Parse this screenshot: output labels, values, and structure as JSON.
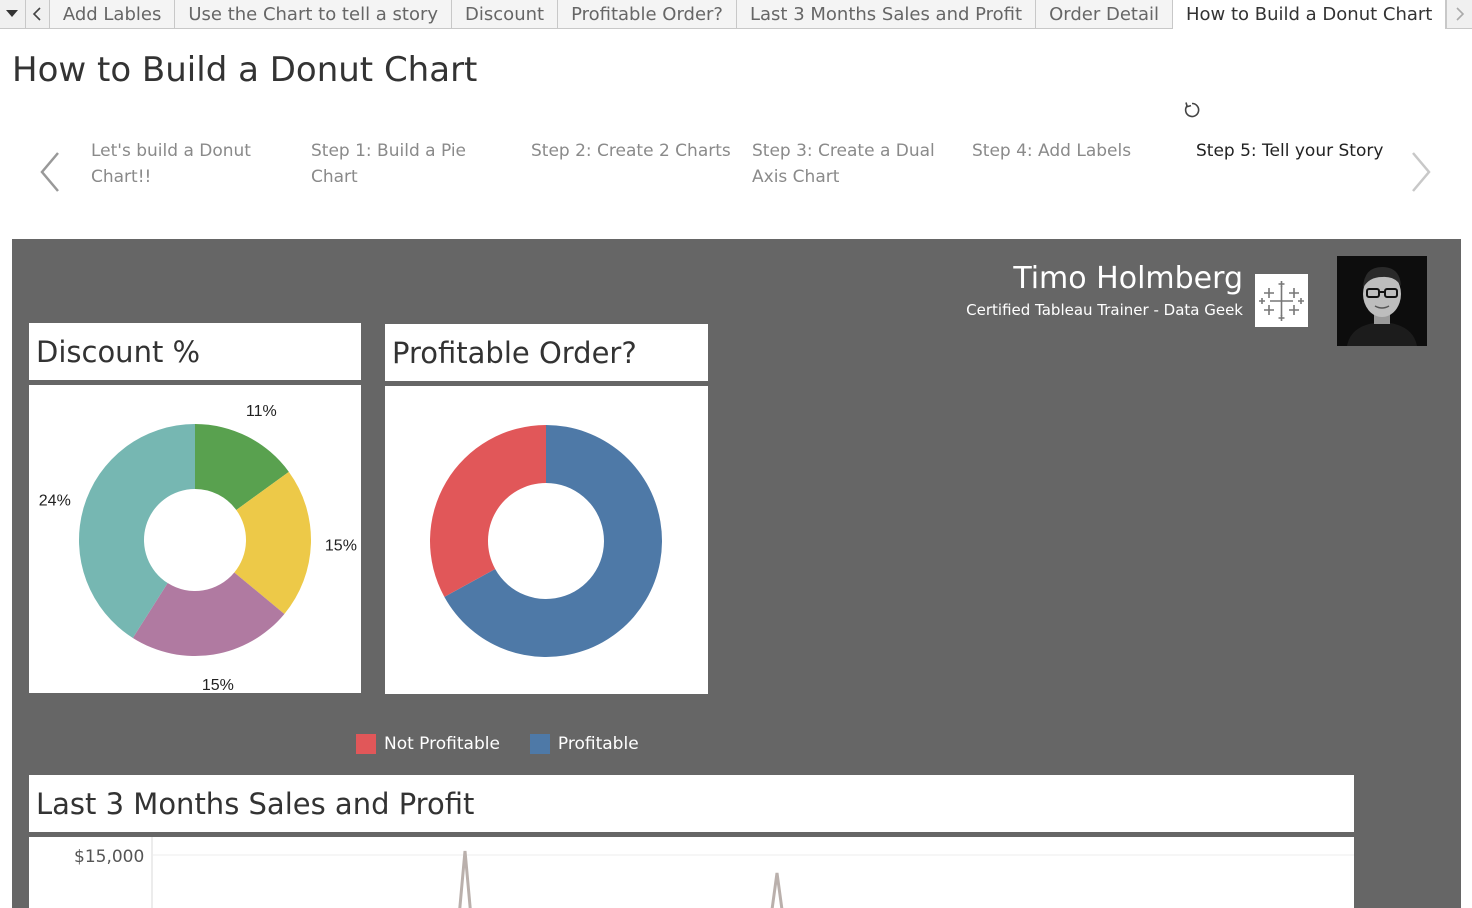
{
  "tabs": {
    "items": [
      "Add Lables",
      "Use the Chart to tell a story",
      "Discount",
      "Profitable Order?",
      "Last 3 Months Sales and Profit",
      "Order Detail",
      "How to Build a Donut Chart"
    ],
    "active": "How to Build a Donut Chart"
  },
  "page": {
    "title": "How to Build a Donut Chart"
  },
  "story": {
    "steps": [
      {
        "label": "Let's build a Donut Chart!!"
      },
      {
        "label": "Step 1: Build a Pie Chart"
      },
      {
        "label": "Step 2: Create 2 Charts"
      },
      {
        "label": "Step 3: Create a Dual Axis Chart"
      },
      {
        "label": "Step 4: Add Labels"
      },
      {
        "label": "Step 5: Tell your Story"
      }
    ],
    "active_index": 5
  },
  "author": {
    "name": "Timo Holmberg",
    "subtitle": "Certified Tableau Trainer - Data Geek"
  },
  "colors": {
    "dashboard_bg": "#666666",
    "green": "#59a14f",
    "yellow": "#edc948",
    "purple": "#b07aa1",
    "teal": "#76b7b2",
    "not_profitable": "#e15759",
    "profitable": "#4e79a7",
    "line": "#bab0ac"
  },
  "panels": {
    "discount_title": "Discount %",
    "profit_title": "Profitable Order?",
    "sales_title": "Last 3 Months Sales and Profit"
  },
  "legend": {
    "not_profitable": "Not Profitable",
    "profitable": "Profitable"
  },
  "chart_data": [
    {
      "type": "pie",
      "title": "Discount %",
      "slices": [
        {
          "value": 15,
          "label": "11%",
          "color": "#59a14f"
        },
        {
          "value": 21,
          "label": "15%",
          "color": "#edc948"
        },
        {
          "value": 23,
          "label": "15%",
          "color": "#b07aa1"
        },
        {
          "value": 41,
          "label": "24%",
          "color": "#76b7b2"
        }
      ]
    },
    {
      "type": "pie",
      "title": "Profitable Order?",
      "slices": [
        {
          "name": "Profitable",
          "value": 67,
          "color": "#4e79a7"
        },
        {
          "name": "Not Profitable",
          "value": 33,
          "color": "#e15759"
        }
      ]
    },
    {
      "type": "line",
      "title": "Last 3 Months Sales and Profit",
      "y_tick_labels": [
        "$15,000"
      ]
    }
  ]
}
